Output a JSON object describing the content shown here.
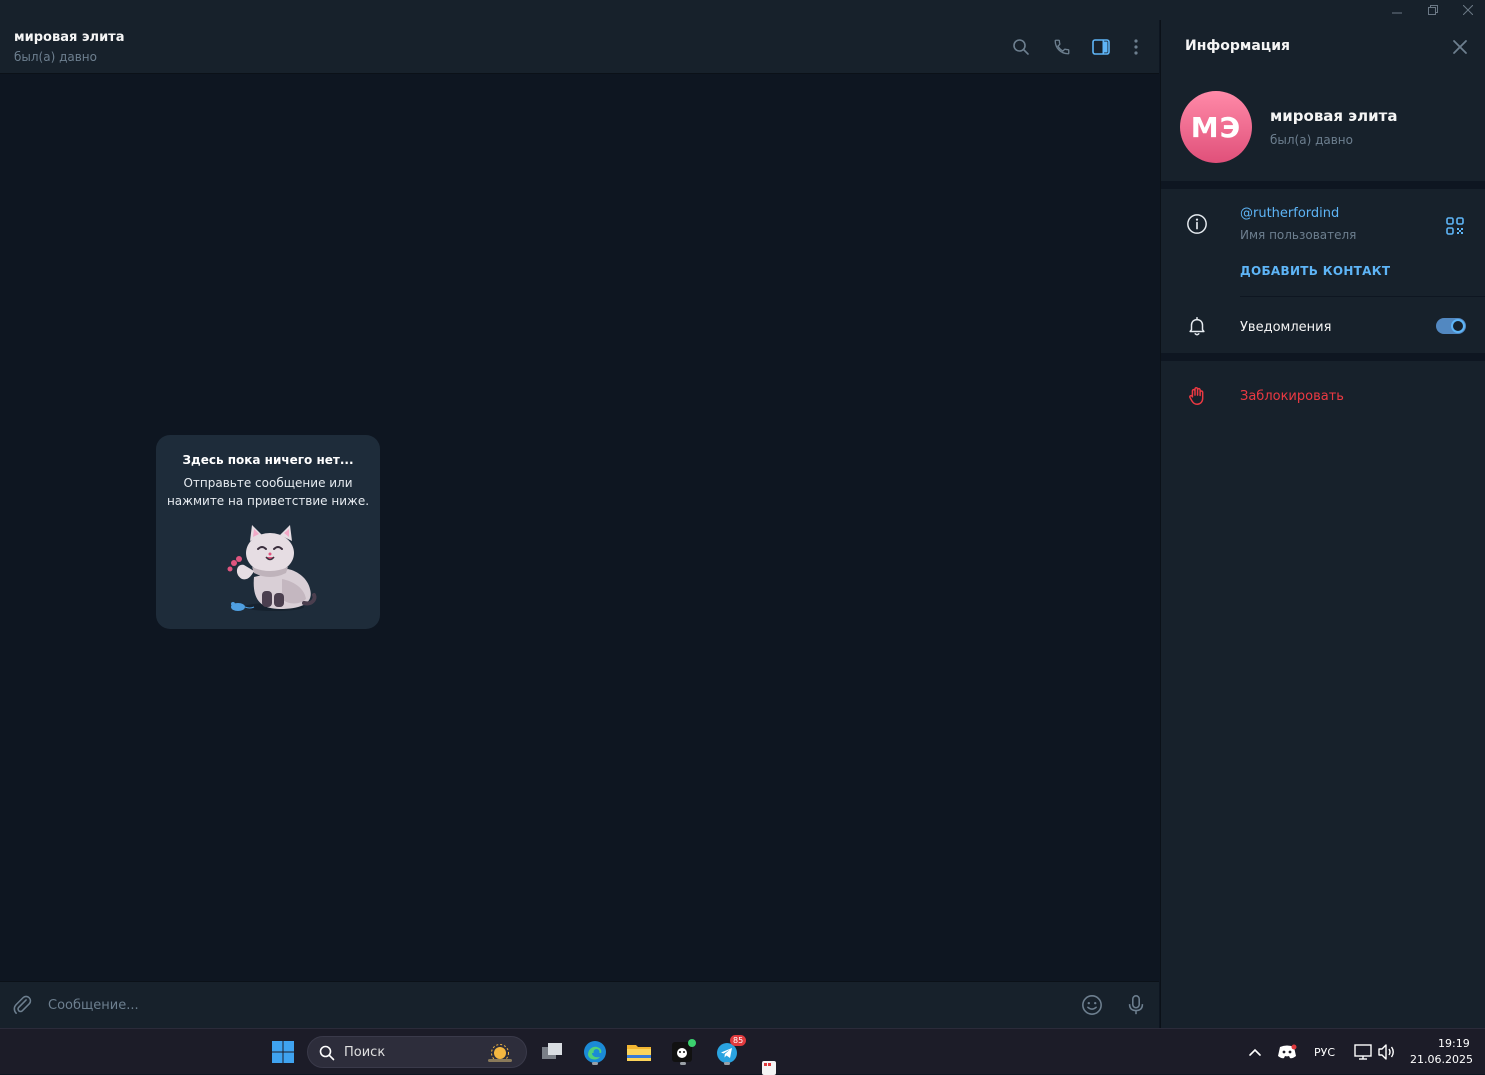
{
  "chat": {
    "title": "мировая элита",
    "status": "был(а) давно"
  },
  "empty_state": {
    "title": "Здесь пока ничего нет...",
    "text": "Отправьте сообщение или нажмите на приветствие ниже."
  },
  "composer": {
    "placeholder": "Сообщение..."
  },
  "info": {
    "header": "Информация",
    "avatar_initials": "МЭ",
    "name": "мировая элита",
    "status": "был(а) давно",
    "username": "@rutherfordind",
    "username_caption": "Имя пользователя",
    "add_contact": "ДОБАВИТЬ КОНТАКТ",
    "notifications_label": "Уведомления",
    "notifications_on": true,
    "block_label": "Заблокировать"
  },
  "taskbar": {
    "search_label": "Поиск",
    "telegram_badge": "85",
    "language": "РУС",
    "time": "19:19",
    "date": "21.06.2025"
  },
  "colors": {
    "accent": "#5eb5f7",
    "danger": "#ec3942",
    "panel": "#17212b",
    "background": "#0e1621"
  }
}
